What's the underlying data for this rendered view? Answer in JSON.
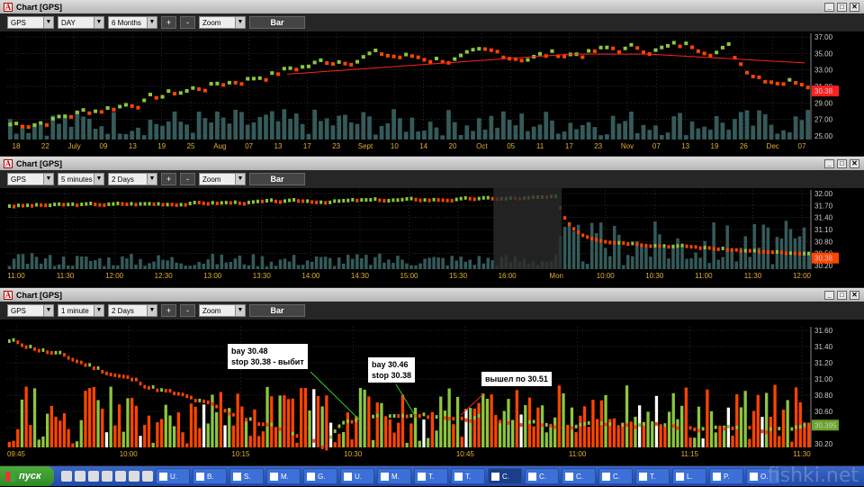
{
  "panels": [
    {
      "title": "Chart [GPS]",
      "symbol": "GPS",
      "interval": "DAY",
      "range": "6 Months",
      "zoom": "Zoom",
      "mode": "Bar",
      "plus": "+",
      "minus": "-",
      "price_label": "30.38",
      "y_ticks": [
        "37.00",
        "35.00",
        "33.00",
        "31.00",
        "29.00",
        "27.00",
        "25.00"
      ],
      "x_ticks": [
        "18",
        "22",
        "July",
        "09",
        "13",
        "19",
        "25",
        "Aug",
        "07",
        "13",
        "17",
        "23",
        "Sept",
        "10",
        "14",
        "20",
        "Oct",
        "05",
        "11",
        "17",
        "23",
        "Nov",
        "07",
        "13",
        "19",
        "26",
        "Dec",
        "07"
      ]
    },
    {
      "title": "Chart [GPS]",
      "symbol": "GPS",
      "interval": "5 minutes",
      "range": "2 Days",
      "zoom": "Zoom",
      "mode": "Bar",
      "plus": "+",
      "minus": "-",
      "price_label": "30.38",
      "y_ticks": [
        "32.00",
        "31.70",
        "31.40",
        "31.10",
        "30.80",
        "30.50",
        "30.20"
      ],
      "x_ticks": [
        "11:00",
        "11:30",
        "12:00",
        "12:30",
        "13:00",
        "13:30",
        "14:00",
        "14:30",
        "15:00",
        "15:30",
        "16:00",
        "Mon",
        "10:00",
        "10:30",
        "11:00",
        "11:30",
        "12:00"
      ]
    },
    {
      "title": "Chart [GPS]",
      "symbol": "GPS",
      "interval": "1 minute",
      "range": "2 Days",
      "zoom": "Zoom",
      "mode": "Bar",
      "plus": "+",
      "minus": "-",
      "price_label": "30.395",
      "y_ticks": [
        "31.60",
        "31.40",
        "31.20",
        "31.00",
        "30.80",
        "30.60",
        "30.40",
        "30.20"
      ],
      "x_ticks": [
        "09:45",
        "10:00",
        "10:15",
        "10:30",
        "10:45",
        "11:00",
        "11:15",
        "11:30"
      ]
    }
  ],
  "annotations": [
    {
      "line1": "bay 30.48",
      "line2": "stop 30.38 - выбит"
    },
    {
      "line1": "bay 30.46",
      "line2": "stop 30.38"
    },
    {
      "line1": "вышел по 30.51",
      "line2": ""
    }
  ],
  "taskbar": {
    "start": "пуск",
    "items": [
      "U.",
      "B.",
      "S.",
      "M.",
      "G.",
      "U.",
      "M.",
      "T.",
      "T.",
      "C.",
      "C.",
      "C.",
      "C.",
      "T.",
      "L.",
      "P.",
      "O."
    ]
  },
  "watermark": "fishki.net",
  "colors": {
    "up": "#8cc63f",
    "down": "#ff4500",
    "volume": "#355a5a",
    "avg_line": "#ff2020",
    "grid": "#505050"
  }
}
